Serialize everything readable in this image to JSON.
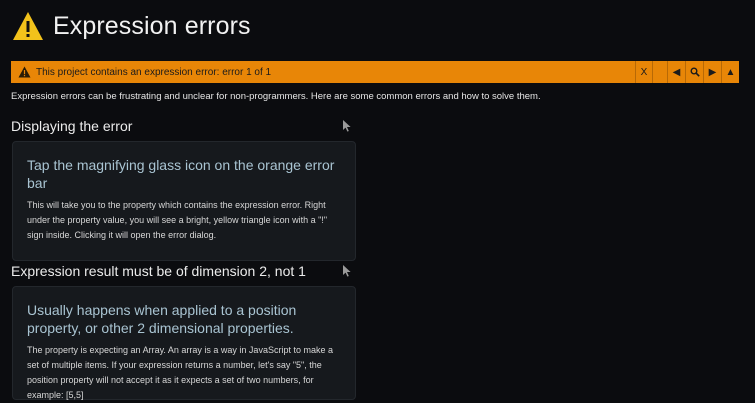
{
  "header": {
    "title": "Expression errors"
  },
  "error_bar": {
    "message": "This project contains an expression error: error 1 of 1",
    "close_label": "X",
    "prev_symbol": "◀",
    "next_symbol": "▶",
    "up_symbol": "▲",
    "bar_color": "#e88607"
  },
  "intro": "Expression errors can be frustrating and unclear for non-programmers. Here are some common errors and how to solve them.",
  "sections": [
    {
      "heading": "Displaying the error",
      "card_title": "Tap the magnifying glass icon on the orange error bar",
      "card_body": "This will take you to the property which contains the expression error. Right under the property value, you will see a bright, yellow triangle icon with a \"!\" sign inside. Clicking it will open the error dialog."
    },
    {
      "heading": "Expression result must be of dimension 2, not 1",
      "card_title": "Usually happens when applied to a position property, or other 2 dimensional properties.",
      "card_body": "The property is expecting an Array. An array is a way in JavaScript to make a set of multiple items. If your expression returns a number, let's say \"5\", the position property will not accept it as it expects a set of two numbers, for example: [5,5]"
    }
  ]
}
